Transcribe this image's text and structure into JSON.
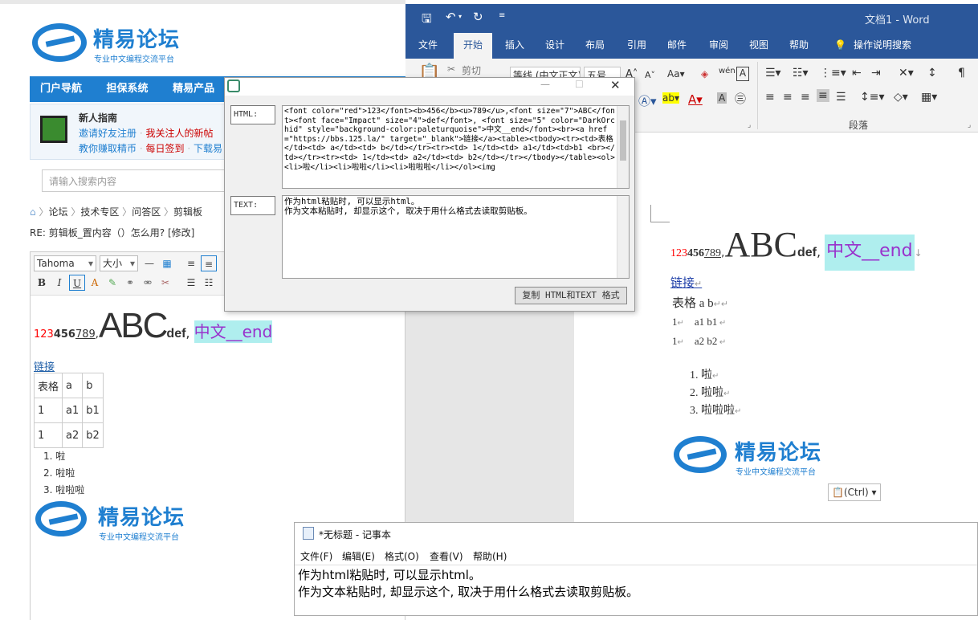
{
  "forum": {
    "logo_title": "精易论坛",
    "logo_subtitle": "专业中文编程交流平台",
    "nav": [
      "门户导航",
      "担保系统",
      "精易产品"
    ],
    "guide_title": "新人指南",
    "guide_line1": [
      "邀请好友注册",
      "我关注人的新帖"
    ],
    "guide_line2": [
      "教你赚取精币",
      "每日签到",
      "下载易"
    ],
    "search_placeholder": "请输入搜索内容",
    "breadcrumb": [
      "论坛",
      "技术专区",
      "问答区",
      "剪辑板"
    ],
    "reply_title": "RE: 剪辑板_置内容（）怎么用? [修改]",
    "editor": {
      "font": "Tahoma",
      "size": "大小"
    },
    "content": {
      "num_red": "123",
      "num_bold": "456",
      "num_under": "789",
      "comma": ",",
      "abc": "ABC",
      "def": "def",
      "sep": ", ",
      "cn": "中文__end",
      "link": "链接",
      "table": [
        [
          "表格",
          "a",
          "b"
        ],
        [
          "1",
          "a1",
          "b1"
        ],
        [
          "1",
          "a2",
          "b2"
        ]
      ],
      "list": [
        "啦",
        "啦啦",
        "啦啦啦"
      ]
    }
  },
  "word": {
    "title": "文档1 - Word",
    "tabs": [
      "文件",
      "开始",
      "插入",
      "设计",
      "布局",
      "引用",
      "邮件",
      "审阅",
      "视图",
      "帮助",
      "操作说明搜索"
    ],
    "active_tab": "开始",
    "cut_label": "剪切",
    "font_name": "等线 (中文正文)",
    "font_size": "五号",
    "paragraph_group": "段落",
    "paste_options": "(Ctrl)",
    "doc": {
      "num_red": "123",
      "num_bold": "456",
      "num_under": "789",
      "comma": ",",
      "abc": "ABC",
      "def": "def",
      "sep": ", ",
      "cn": "中文__end",
      "link": "链接",
      "row1": "表格 a b",
      "row2": [
        "1",
        "a1 b1"
      ],
      "row3": [
        "1",
        "a2 b2"
      ],
      "list": [
        "1. 啦",
        "2. 啦啦",
        "3. 啦啦啦"
      ]
    }
  },
  "dialog": {
    "html_label": "HTML:",
    "text_label": "TEXT:",
    "html_content": "<font color=\"red\">123</font><b>456</b><u>789</u>,<font size=\"7\">ABC</font><font face=\"Impact\" size=\"4\">def</font>, <font size=\"5\" color=\"DarkOrchid\" style=\"background-color:paleturquoise\">中文__end</font><br><a href=\"https://bbs.125.la/\" target=\"_blank\">链接</a><table><tbody><tr><td>表格</td><td> a</td><td> b</td></tr><tr><td> 1</td><td> a1</td><td>b1 <br></td></tr><tr><td> 1</td><td> a2</td><td> b2</td></tr></tbody></table><ol><li>啦</li><li>啦啦</li><li>啦啦啦</li></ol><img",
    "text_content": "作为html粘贴时, 可以显示html。\n作为文本粘贴时, 却显示这个, 取决于用什么格式去读取剪贴板。",
    "copy_button": "复制 HTML和TEXT 格式"
  },
  "notepad": {
    "title": "*无标题 - 记事本",
    "menu": [
      "文件(F)",
      "编辑(E)",
      "格式(O)",
      "查看(V)",
      "帮助(H)"
    ],
    "line1": "作为html粘贴时, 可以显示html。",
    "line2": "作为文本粘贴时, 却显示这个, 取决于用什么格式去读取剪贴板。"
  },
  "colors": {
    "forum_blue": "#1f7fd0",
    "word_blue": "#2b579a",
    "orchid": "#9932cc",
    "turquoise": "#afeeee"
  }
}
